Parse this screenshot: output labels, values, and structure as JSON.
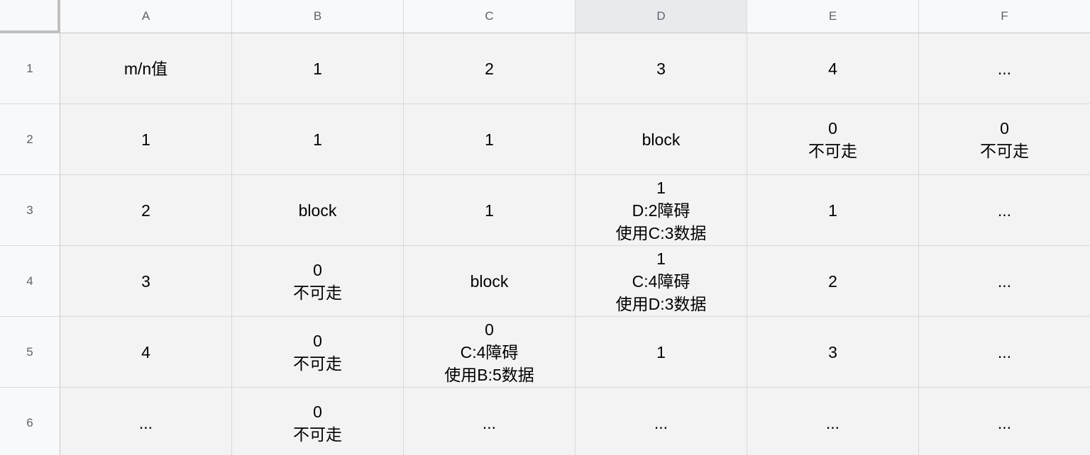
{
  "columns": [
    "A",
    "B",
    "C",
    "D",
    "E",
    "F"
  ],
  "selected_column": "D",
  "rows": [
    {
      "number": "1",
      "cells": [
        "m/n值",
        "1",
        "2",
        "3",
        "4",
        "..."
      ]
    },
    {
      "number": "2",
      "cells": [
        "1",
        "1",
        "1",
        "block",
        "0\n不可走",
        "0\n不可走"
      ]
    },
    {
      "number": "3",
      "cells": [
        "2",
        "block",
        "1",
        "1\nD:2障碍\n使用C:3数据",
        "1",
        "..."
      ]
    },
    {
      "number": "4",
      "cells": [
        "3",
        "0\n不可走",
        "block",
        "1\nC:4障碍\n使用D:3数据",
        "2",
        "..."
      ]
    },
    {
      "number": "5",
      "cells": [
        "4",
        "0\n不可走",
        "0\nC:4障碍\n使用B:5数据",
        "1",
        "3",
        "..."
      ]
    },
    {
      "number": "6",
      "cells": [
        "...",
        "0\n不可走",
        "...",
        "...",
        "...",
        "..."
      ]
    }
  ]
}
